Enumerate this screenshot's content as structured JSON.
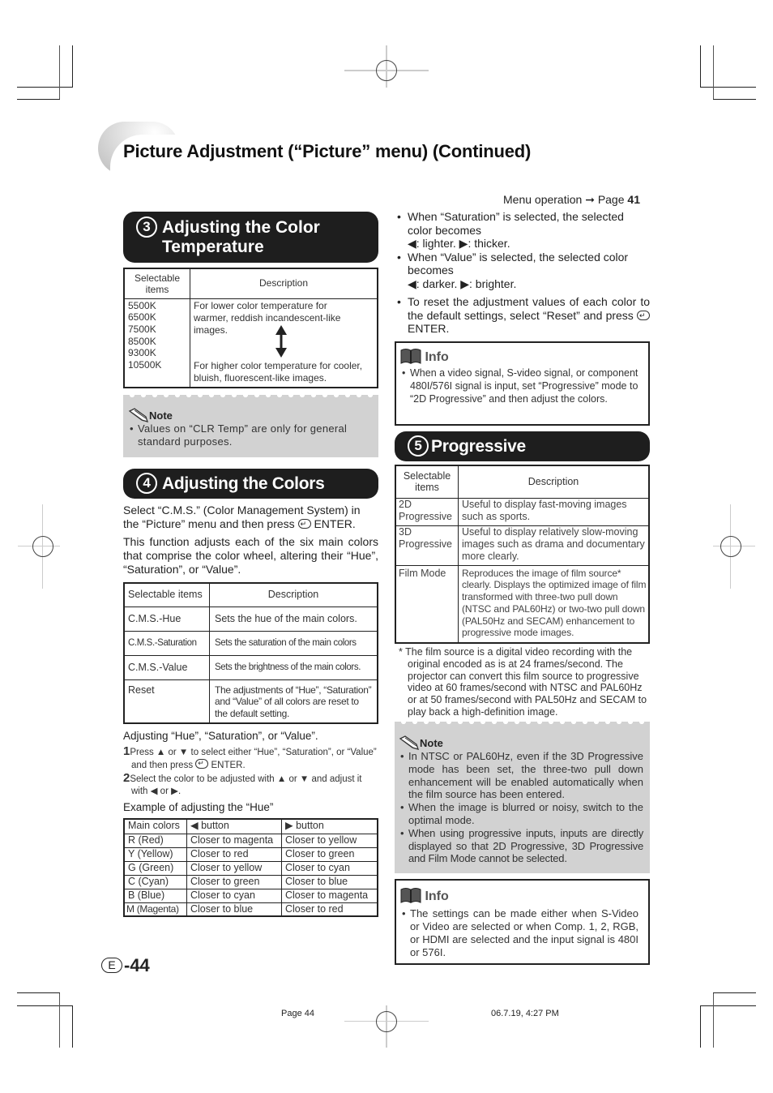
{
  "page": {
    "title": "Picture Adjustment (“Picture” menu) (Continued)",
    "menu_operation": "Menu operation",
    "menu_operation_arrow": "➞",
    "menu_operation_page_label": "Page",
    "menu_operation_page": "41",
    "page_lang_badge": "E",
    "page_number": "-44",
    "footer_left": "Page 44",
    "footer_right": "06.7.19, 4:27 PM"
  },
  "color_temp": {
    "number": "3",
    "heading_line1": "Adjusting the Color",
    "heading_line2": "Temperature",
    "headers": [
      "Selectable items",
      "Description"
    ],
    "items": [
      "5500K",
      "6500K",
      "7500K",
      "8500K",
      "9300K",
      "10500K"
    ],
    "desc_low": "For lower color temperature for warmer, reddish incandescent-like images.",
    "desc_high": "For higher color temperature for cooler, bluish, fluorescent-like images.",
    "note_title": "Note",
    "note_items": [
      "Values on “CLR Temp” are only for general standard purposes."
    ]
  },
  "colors": {
    "number": "4",
    "heading": "Adjusting the Colors",
    "intro_a": "Select “C.M.S.” (Color Management System) in the “Picture” menu and then press",
    "intro_a_enter": "ENTER.",
    "intro_b": "This function adjusts each of the six main colors that comprise the color wheel, altering their “Hue”, “Saturation”, or “Value”.",
    "headers": [
      "Selectable items",
      "Description"
    ],
    "rows": [
      {
        "item": "C.M.S.-Hue",
        "desc": "Sets the hue of the main colors."
      },
      {
        "item": "C.M.S.-Saturation",
        "desc": "Sets the saturation of the main colors"
      },
      {
        "item": "C.M.S.-Value",
        "desc": "Sets the brightness of the main colors."
      },
      {
        "item": "Reset",
        "desc": "The adjustments of “Hue”, “Saturation” and “Value” of all colors are reset to the default setting."
      }
    ],
    "adjust_heading": "Adjusting “Hue”, “Saturation”, or “Value”.",
    "steps": [
      {
        "num": "1",
        "text": "Press ▲ or ▼ to select either “Hue”, “Saturation”, or “Value” and then press",
        "suffix": "ENTER."
      },
      {
        "num": "2",
        "text": "Select the color to be adjusted with ▲ or ▼ and adjust it with ◀ or ▶.",
        "suffix": ""
      }
    ],
    "example_heading": "Example of adjusting the “Hue”",
    "hue_headers": [
      "Main colors",
      "◀ button",
      "▶ button"
    ],
    "hue_rows": [
      [
        "R (Red)",
        "Closer to magenta",
        "Closer to yellow"
      ],
      [
        "Y (Yellow)",
        "Closer to red",
        "Closer to green"
      ],
      [
        "G (Green)",
        "Closer to yellow",
        "Closer to cyan"
      ],
      [
        "C (Cyan)",
        "Closer to green",
        "Closer to blue"
      ],
      [
        "B (Blue)",
        "Closer to cyan",
        "Closer to magenta"
      ],
      [
        "M (Magenta)",
        "Closer to blue",
        "Closer to red"
      ]
    ]
  },
  "right_bullets": [
    {
      "line": "When “Saturation” is selected, the selected color becomes",
      "sub": "◀: lighter.  ▶: thicker."
    },
    {
      "line": "When “Value” is selected, the selected color becomes",
      "sub": "◀: darker.  ▶: brighter."
    },
    {
      "line": "To reset the adjustment values of each color to the default settings, select “Reset” and press",
      "sub": "ENTER."
    }
  ],
  "info1": {
    "title": "Info",
    "items": [
      "When a video signal, S-video signal, or component 480I/576I signal is input, set “Progressive” mode to “2D Progressive” and then adjust the colors."
    ]
  },
  "progressive": {
    "number": "5",
    "heading": "Progressive",
    "headers": [
      "Selectable items",
      "Description"
    ],
    "rows": [
      {
        "item": "2D Progressive",
        "desc": "Useful to display fast-moving images such as sports."
      },
      {
        "item": "3D Progressive",
        "desc": "Useful to display relatively slow-moving images such as drama and documentary more clearly."
      },
      {
        "item": "Film Mode",
        "desc": "Reproduces the image of film source* clearly. Displays the optimized image of film transformed with three-two pull down (NTSC and PAL60Hz) or two-two pull down (PAL50Hz and SECAM) enhancement to progressive mode images."
      }
    ],
    "footnote": "* The film source is a digital video recording with the original encoded as is at 24 frames/second. The projector can convert this film source to progressive video at 60 frames/second with NTSC and PAL60Hz or at 50 frames/second with PAL50Hz and SECAM to play back a high-definition image.",
    "note_title": "Note",
    "note_items": [
      "In NTSC or PAL60Hz, even if the 3D Progressive mode has been set, the three-two pull down enhancement will be enabled automatically when the film source has been entered.",
      "When the image is blurred or noisy, switch to the optimal mode.",
      "When using progressive inputs, inputs are directly displayed so that 2D Progressive, 3D Progressive and Film Mode cannot be selected."
    ],
    "info_title": "Info",
    "info_items": [
      "The settings can be made either when S-Video or Video are selected or when Comp. 1, 2, RGB, or HDMI are selected and the input signal is 480I or 576I."
    ]
  }
}
